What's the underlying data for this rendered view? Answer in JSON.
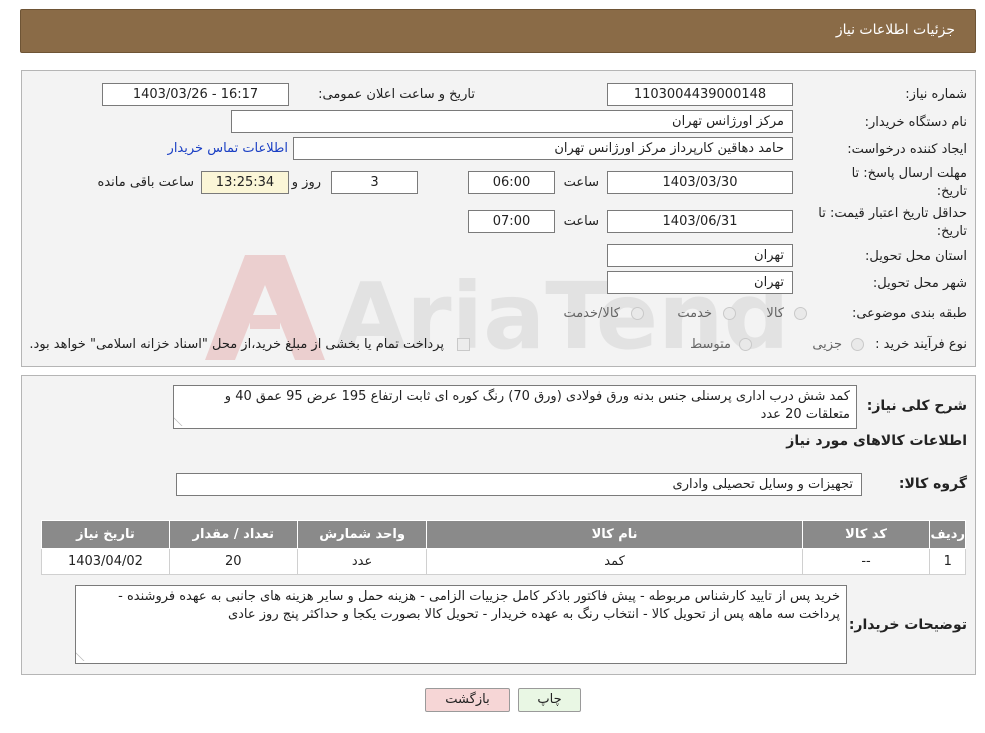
{
  "header": {
    "title": "جزئیات اطلاعات نیاز"
  },
  "fields": {
    "need_number_label": "شماره نیاز:",
    "need_number": "1103004439000148",
    "announce_label": "تاریخ و ساعت اعلان عمومی:",
    "announce_value": "1403/03/26 - 16:17",
    "buyer_org_label": "نام دستگاه خریدار:",
    "buyer_org": "مرکز اورژانس تهران",
    "creator_label": "ایجاد کننده درخواست:",
    "creator": "حامد دهاقین کارپرداز مرکز اورژانس تهران",
    "contact_link": "اطلاعات تماس خریدار",
    "deadline_label_1": "مهلت ارسال پاسخ: تا",
    "deadline_label_2": "تاریخ:",
    "deadline_date": "1403/03/30",
    "time_label": "ساعت",
    "deadline_time": "06:00",
    "days_value": "3",
    "days_label": "روز و",
    "remaining_time": "13:25:34",
    "remaining_label": "ساعت باقی مانده",
    "validity_label_1": "حداقل تاریخ اعتبار قیمت: تا",
    "validity_label_2": "تاریخ:",
    "validity_date": "1403/06/31",
    "validity_time": "07:00",
    "province_label": "استان محل تحویل:",
    "province": "تهران",
    "city_label": "شهر محل تحویل:",
    "city": "تهران",
    "category_label": "طبقه بندی موضوعی:",
    "category_options": [
      "کالا",
      "خدمت",
      "کالا/خدمت"
    ],
    "process_label": "نوع فرآیند خرید :",
    "process_options": [
      "جزیی",
      "متوسط"
    ],
    "process_note": "پرداخت تمام یا بخشی از مبلغ خرید،از محل \"اسناد خزانه اسلامی\" خواهد بود."
  },
  "summary": {
    "label": "شرح کلی نیاز:",
    "text": "کمد شش درب اداری پرسنلی جنس بدنه ورق فولادی (ورق 70) رنگ کوره ای ثابت ارتفاع 195 عرض 95 عمق 40  و متعلقات 20 عدد",
    "goods_info_title": "اطلاعات کالاهای مورد نیاز",
    "group_label": "گروه کالا:",
    "group_value": "تجهیزات و وسایل تحصیلی واداری"
  },
  "table": {
    "headers": [
      "ردیف",
      "کد کالا",
      "نام کالا",
      "واحد شمارش",
      "تعداد / مقدار",
      "تاریخ نیاز"
    ],
    "rows": [
      [
        "1",
        "--",
        "کمد",
        "عدد",
        "20",
        "1403/04/02"
      ]
    ]
  },
  "buyer_notes": {
    "label": "توضیحات خریدار:",
    "text": "خرید پس از تایید کارشناس مربوطه - پیش فاکتور باذکر کامل جزییات الزامی - هزینه حمل و سایر هزینه های جانبی به عهده فروشنده - پرداخت سه ماهه پس از تحویل کالا - انتخاب رنگ به عهده خریدار - تحویل کالا بصورت یکجا و حداکثر پنج روز عادی"
  },
  "buttons": {
    "print": "چاپ",
    "back": "بازگشت"
  },
  "watermark": {
    "text": "AriaTender.neT"
  },
  "colors": {
    "header": "#8a6b47",
    "table_header": "#8a8a8a",
    "link": "#1a3fc4",
    "back_button": "#f6d6d6",
    "print_button": "#e9f7e4",
    "remaining_box": "#fbf6d7"
  }
}
